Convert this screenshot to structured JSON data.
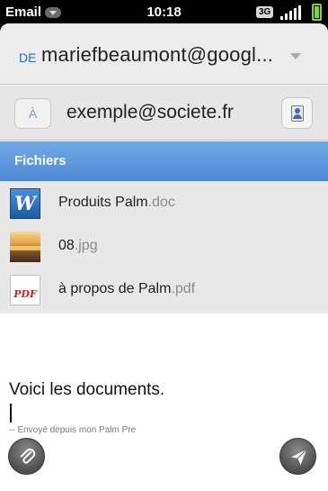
{
  "status_bar": {
    "app_name": "Email",
    "time": "10:18",
    "network": "3G"
  },
  "from": {
    "prefix": "DE",
    "address": "mariefbeaumont@googl..."
  },
  "to": {
    "a_button_label": "À",
    "value": "exemple@societe.fr"
  },
  "attachments": {
    "header": "Fichiers",
    "items": [
      {
        "name": "Produits Palm",
        "ext": ".doc",
        "icon": "word-doc-icon",
        "glyph": "W"
      },
      {
        "name": "08",
        "ext": ".jpg",
        "icon": "photo-thumbnail-icon",
        "glyph": ""
      },
      {
        "name": "à propos de Palm",
        "ext": ".pdf",
        "icon": "pdf-icon",
        "glyph": "PDF"
      }
    ]
  },
  "message": {
    "body": "Voici les documents.",
    "signature": "-- Envoyé depuis mon Palm Pre"
  },
  "colors": {
    "accent": "#5f9ae0",
    "battery": "#7bd33f"
  }
}
